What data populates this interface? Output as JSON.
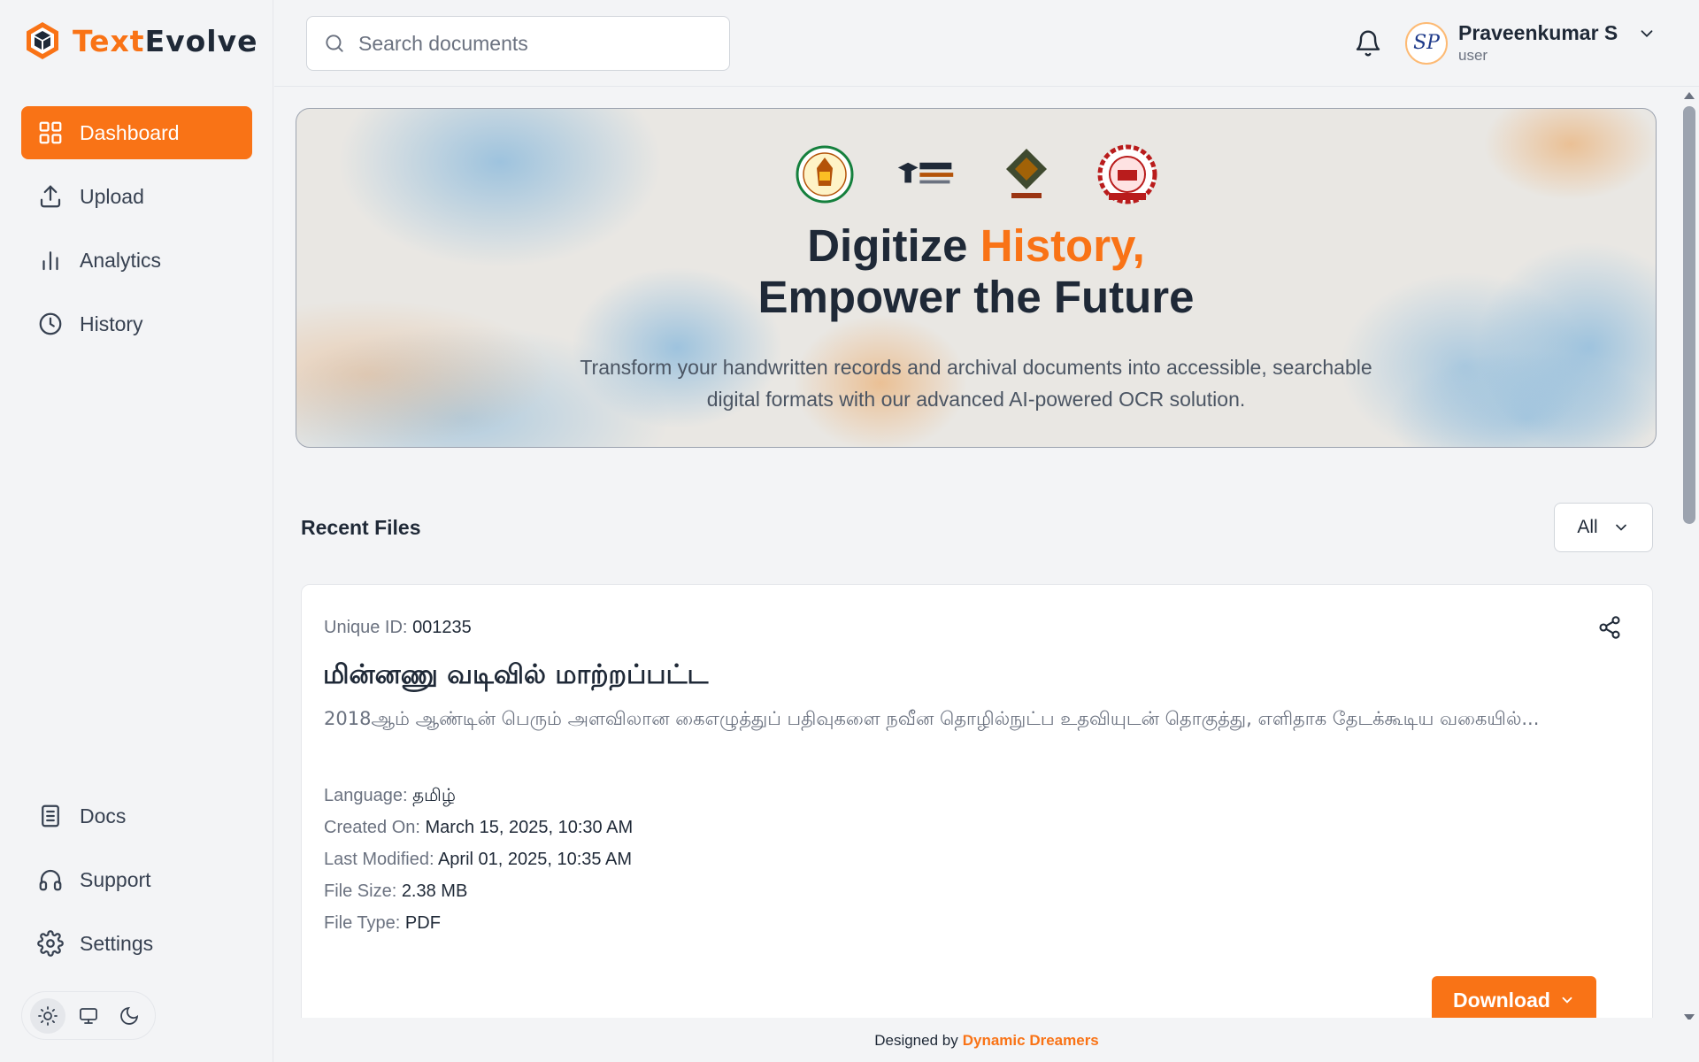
{
  "app": {
    "logo_part1": "Text",
    "logo_part2": "Evolve"
  },
  "sidebar": {
    "items": [
      {
        "label": "Dashboard",
        "icon": "grid-icon",
        "active": true
      },
      {
        "label": "Upload",
        "icon": "upload-icon"
      },
      {
        "label": "Analytics",
        "icon": "bar-chart-icon"
      },
      {
        "label": "History",
        "icon": "clock-icon"
      }
    ],
    "bottom_items": [
      {
        "label": "Docs",
        "icon": "document-icon"
      },
      {
        "label": "Support",
        "icon": "headset-icon"
      },
      {
        "label": "Settings",
        "icon": "gear-icon"
      }
    ],
    "theme_modes": [
      "light",
      "system",
      "dark"
    ],
    "theme_selected": "light"
  },
  "header": {
    "search_placeholder": "Search documents",
    "user_name": "Praveenkumar S",
    "user_role": "user",
    "avatar_initials": "SP"
  },
  "hero": {
    "title_part1": "Digitize ",
    "title_accent": "History,",
    "title_line2": "Empower the Future",
    "subtitle_line1": "Transform your handwritten records and archival documents into accessible, searchable",
    "subtitle_line2": "digital formats with our advanced AI-powered OCR solution."
  },
  "recent": {
    "title": "Recent Files",
    "filter_value": "All"
  },
  "file_card": {
    "uid_label": "Unique ID:",
    "uid_value": "001235",
    "title": "மின்னணு வடிவில் மாற்றப்பட்ட",
    "description": "2018ஆம் ஆண்டின் பெரும் அளவிலான கைஎழுத்துப் பதிவுகளை நவீன தொழில்நுட்ப உதவியுடன் தொகுத்து, எளிதாக தேடக்கூடிய வகையில்...",
    "meta": [
      {
        "label": "Language:",
        "value": "தமிழ்"
      },
      {
        "label": "Created On:",
        "value": "March 15, 2025, 10:30 AM"
      },
      {
        "label": "Last Modified:",
        "value": "April 01, 2025, 10:35 AM"
      },
      {
        "label": "File Size:",
        "value": "2.38 MB"
      },
      {
        "label": "File Type:",
        "value": "PDF"
      }
    ],
    "download_label": "Download"
  },
  "footer": {
    "prefix": "Designed by",
    "brand": "Dynamic Dreamers"
  },
  "colors": {
    "accent": "#f97316",
    "text": "#1f2937",
    "muted": "#6b7280"
  }
}
